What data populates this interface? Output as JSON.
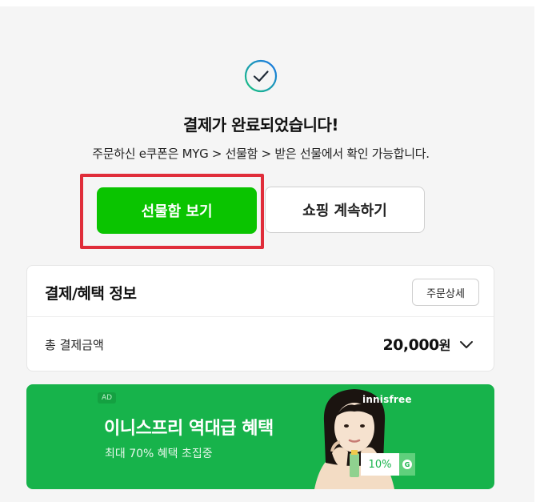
{
  "status": {
    "title": "결제가 완료되었습니다!",
    "message": "주문하신 e쿠폰은 MYG > 선물함 > 받은 선물에서 확인 가능합니다."
  },
  "actions": {
    "primary_label": "선물함 보기",
    "secondary_label": "쇼핑 계속하기"
  },
  "payment_card": {
    "title": "결제/혜택 정보",
    "detail_button": "주문상세",
    "total_label": "총 결제금액",
    "total_amount": "20,000",
    "total_unit": "원"
  },
  "ad_banner": {
    "tag": "AD",
    "title": "이니스프리 역대급 혜택",
    "subtitle": "최대 70% 혜택 초집중",
    "brand": "innisfree",
    "badge": "10%",
    "coin_letter": "G"
  },
  "colors": {
    "primary_green": "#0ac400",
    "highlight_red": "#e02d3a",
    "ad_green": "#17b34b",
    "check_gradient_start": "#19c37d",
    "check_gradient_end": "#1a73e8"
  },
  "icons": {
    "success": "check-circle-icon",
    "expand": "chevron-down-icon"
  }
}
